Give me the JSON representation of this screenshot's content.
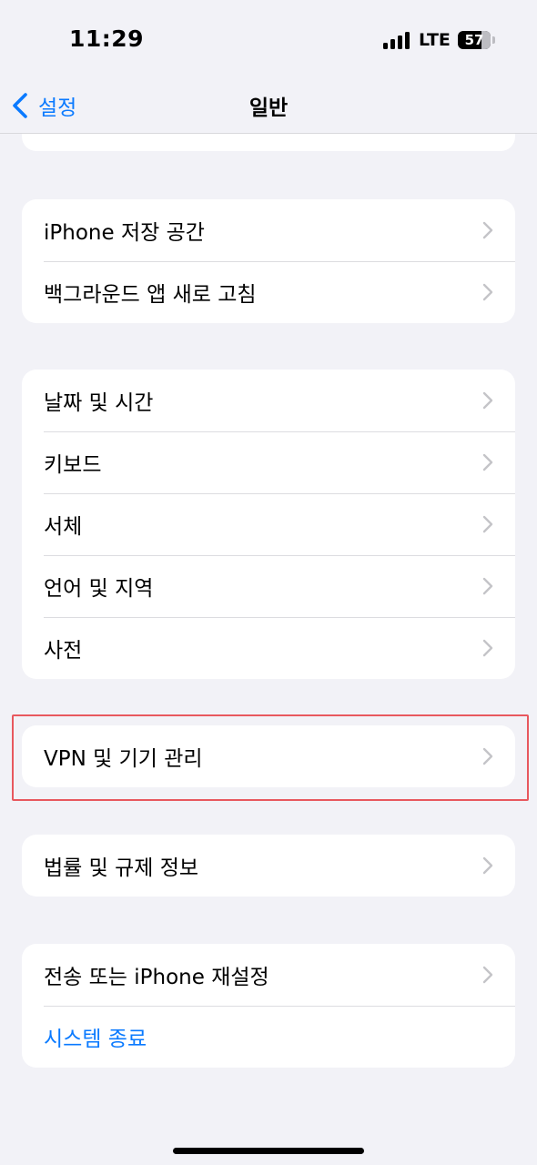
{
  "status": {
    "time": "11:29",
    "network": "LTE",
    "battery": "57",
    "signal_icon": "cellular-signal-icon"
  },
  "nav": {
    "back_label": "설정",
    "title": "일반"
  },
  "groups": [
    {
      "items": [
        "iPhone 저장 공간",
        "백그라운드 앱 새로 고침"
      ]
    },
    {
      "items": [
        "날짜 및 시간",
        "키보드",
        "서체",
        "언어 및 지역",
        "사전"
      ]
    },
    {
      "items": [
        "VPN 및 기기 관리"
      ]
    },
    {
      "items": [
        "법률 및 규제 정보"
      ]
    },
    {
      "items": [
        "전송 또는 iPhone 재설정",
        "시스템 종료"
      ]
    }
  ],
  "colors": {
    "accent": "#0a7aff",
    "background": "#f2f2f7",
    "highlight": "#e8585e"
  }
}
